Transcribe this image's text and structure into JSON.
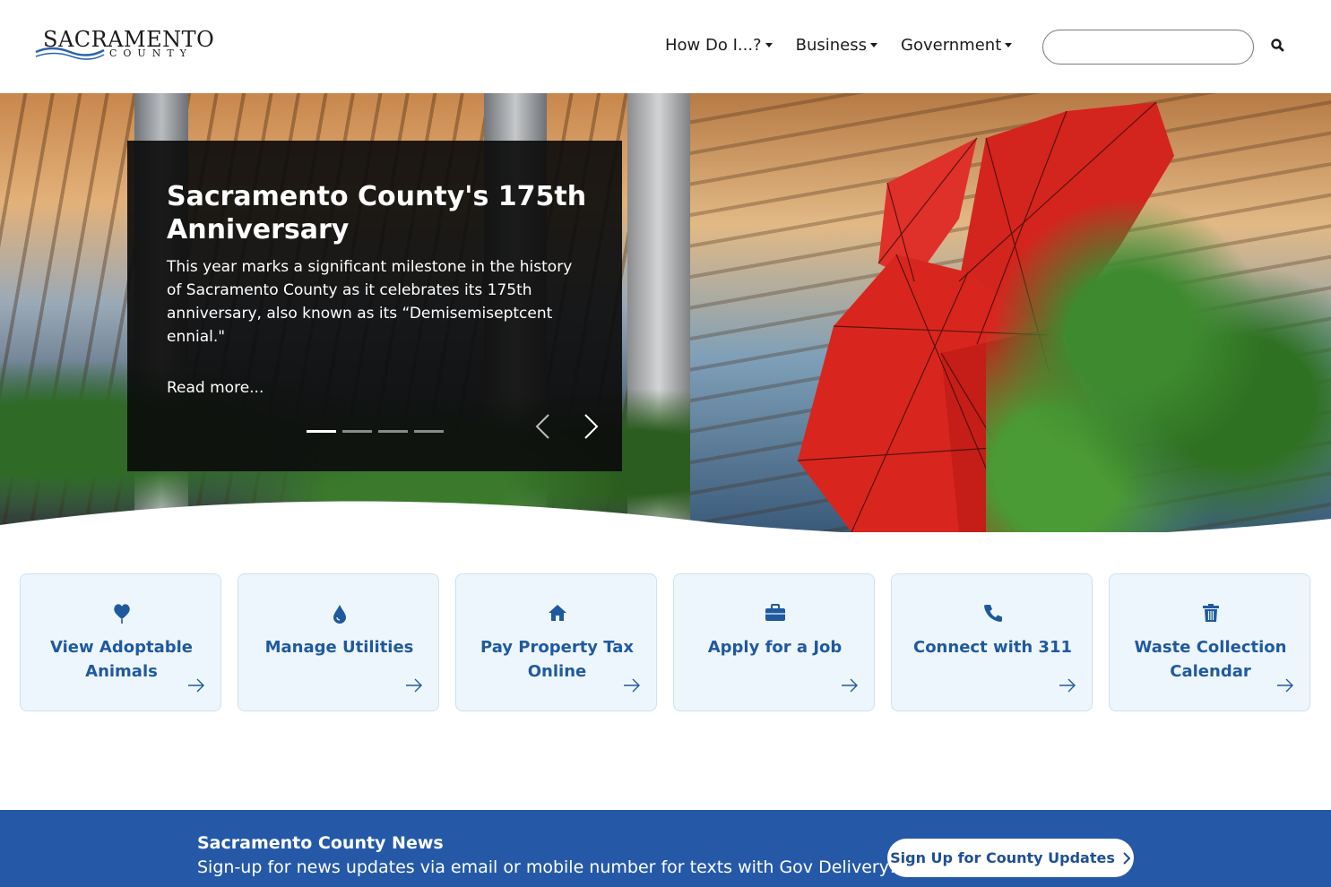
{
  "header": {
    "logo": {
      "word1": "SACRAMENTO",
      "word2": "COUNTY"
    },
    "nav": [
      {
        "label": "How Do I...?"
      },
      {
        "label": "Business"
      },
      {
        "label": "Government"
      }
    ],
    "search": {
      "placeholder": "",
      "value": ""
    },
    "icons": {
      "search": "search-icon",
      "nav_caret": "caret-down-icon"
    }
  },
  "hero": {
    "title": "Sacramento County's 175th Anniversary",
    "text": "This year marks a significant milestone in the history of Sacramento County as it celebrates its 175th anniversary, also known as its “Demisemiseptcent ennial.\"",
    "link": "Read more...",
    "slide_count": 4,
    "active_slide": 1,
    "icons": {
      "prev": "chevron-left-icon",
      "next": "chevron-right-icon"
    }
  },
  "quicklinks": [
    {
      "label": "View Adoptable Animals",
      "icon": "heart-balloon-icon"
    },
    {
      "label": "Manage Utilities",
      "icon": "water-drop-icon"
    },
    {
      "label": "Pay Property Tax Online",
      "icon": "house-icon"
    },
    {
      "label": "Apply for a Job",
      "icon": "briefcase-icon"
    },
    {
      "label": "Connect with 311",
      "icon": "phone-icon"
    },
    {
      "label": "Waste Collection Calendar",
      "icon": "trash-can-icon"
    }
  ],
  "news": {
    "title": "Sacramento County News",
    "text": "Sign-up for news updates via email or mobile number for texts with Gov Delivery!",
    "button": "Sign Up for County Updates"
  },
  "colors": {
    "brand_blue": "#2559a8",
    "link_blue": "#1f5a9f",
    "card_bg": "#eef6fd",
    "caption_bg": "#0c0c0c"
  }
}
